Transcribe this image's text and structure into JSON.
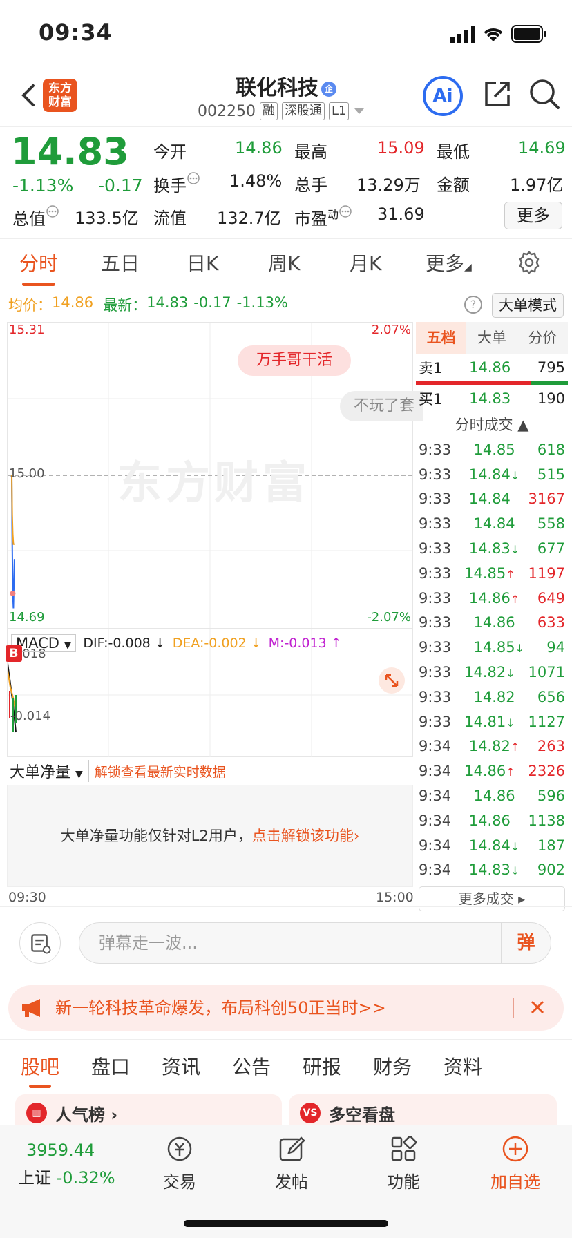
{
  "status": {
    "time": "09:34"
  },
  "header": {
    "logo": "东方财富",
    "title": "联化科技",
    "title_badge": "企",
    "code": "002250",
    "tags": [
      "融",
      "深股通",
      "L1"
    ],
    "ai": "Ai"
  },
  "quote": {
    "price": "14.83",
    "pct": "-1.13%",
    "chg": "-0.17",
    "rows": [
      [
        {
          "l": "今开",
          "v": "14.86",
          "c": "green"
        },
        {
          "l": "最高",
          "v": "15.09",
          "c": "red"
        },
        {
          "l": "最低",
          "v": "14.69",
          "c": "green"
        }
      ],
      [
        {
          "l": "换手",
          "v": "1.48%",
          "c": ""
        },
        {
          "l": "总手",
          "v": "13.29万",
          "c": ""
        },
        {
          "l": "金额",
          "v": "1.97亿",
          "c": ""
        }
      ],
      [
        {
          "l": "总值",
          "v": "133.5亿",
          "c": ""
        },
        {
          "l": "流值",
          "v": "132.7亿",
          "c": ""
        },
        {
          "l": "市盈",
          "v": "31.69",
          "c": ""
        }
      ]
    ],
    "pe_sup": "动",
    "more": "更多"
  },
  "ktabs": [
    "分时",
    "五日",
    "日K",
    "周K",
    "月K",
    "更多"
  ],
  "info": {
    "avg_label": "均价：",
    "avg": "14.86",
    "latest_label": "最新：",
    "latest": "14.83",
    "chg": "-0.17",
    "pct": "-1.13%",
    "help": "?",
    "mode": "大单模式"
  },
  "chart": {
    "y_top": "15.31",
    "y_bottom": "14.69",
    "pct_top": "2.07%",
    "pct_bottom": "-2.07%",
    "y_mid": "15.00",
    "bubble": "万手哥干活",
    "bubble2": "不玩了套",
    "watermark": "东方财富",
    "time_start": "09:30",
    "time_end": "15:00"
  },
  "chart_data": {
    "type": "line",
    "title": "",
    "ylim": [
      14.69,
      15.31
    ],
    "series": [
      {
        "color": "#2d6cf0",
        "points": [
          [
            0,
            15.0
          ],
          [
            0.3,
            14.86
          ],
          [
            0.6,
            14.76
          ],
          [
            1,
            14.73
          ],
          [
            1.6,
            14.83
          ]
        ]
      },
      {
        "color": "#f0a020",
        "points": [
          [
            0,
            15.0
          ],
          [
            0.3,
            14.92
          ],
          [
            0.6,
            14.88
          ],
          [
            1,
            14.86
          ],
          [
            1.6,
            14.86
          ]
        ]
      }
    ]
  },
  "macd": {
    "label": "MACD",
    "dif": "DIF:-0.008 ↓",
    "dea": "DEA:-0.002 ↓",
    "m": "M:-0.013 ↑",
    "top": "0.018",
    "bottom": "-0.014",
    "b": "B"
  },
  "bigorder": {
    "label": "大单净量",
    "link": "解锁查看最新实时数据",
    "msg": "大单净量功能仅针对L2用户，",
    "msg_link": "点击解锁该功能›"
  },
  "rpanel": {
    "tabs": [
      "五档",
      "大单",
      "分价"
    ],
    "sell1": {
      "l": "卖1",
      "p": "14.86",
      "v": "795"
    },
    "buy1": {
      "l": "买1",
      "p": "14.83",
      "v": "190"
    },
    "tick_head": "分时成交 ▲",
    "trades": [
      [
        "9:33",
        "14.85",
        "",
        "618",
        "green"
      ],
      [
        "9:33",
        "14.84",
        "↓",
        "515",
        "green"
      ],
      [
        "9:33",
        "14.84",
        "",
        "3167",
        "red"
      ],
      [
        "9:33",
        "14.84",
        "",
        "558",
        "green"
      ],
      [
        "9:33",
        "14.83",
        "↓",
        "677",
        "green"
      ],
      [
        "9:33",
        "14.85",
        "↑",
        "1197",
        "red"
      ],
      [
        "9:33",
        "14.86",
        "↑",
        "649",
        "red"
      ],
      [
        "9:33",
        "14.86",
        "",
        "633",
        "red"
      ],
      [
        "9:33",
        "14.85",
        "↓",
        "94",
        "green"
      ],
      [
        "9:33",
        "14.82",
        "↓",
        "1071",
        "green"
      ],
      [
        "9:33",
        "14.82",
        "",
        "656",
        "green"
      ],
      [
        "9:33",
        "14.81",
        "↓",
        "1127",
        "green"
      ],
      [
        "9:34",
        "14.82",
        "↑",
        "263",
        "red"
      ],
      [
        "9:34",
        "14.86",
        "↑",
        "2326",
        "red"
      ],
      [
        "9:34",
        "14.86",
        "",
        "596",
        "green"
      ],
      [
        "9:34",
        "14.86",
        "",
        "1138",
        "green"
      ],
      [
        "9:34",
        "14.84",
        "↓",
        "187",
        "green"
      ],
      [
        "9:34",
        "14.83",
        "↓",
        "902",
        "green"
      ]
    ],
    "more": "更多成交 ▸"
  },
  "danmu": {
    "placeholder": "弹幕走一波...",
    "send": "弹"
  },
  "banner": {
    "text": "新一轮科技革命爆发，布局科创50正当时>>"
  },
  "btabs": [
    "股吧",
    "盘口",
    "资讯",
    "公告",
    "研报",
    "财务",
    "资料"
  ],
  "cards": [
    {
      "label": "人气榜 ›"
    },
    {
      "label": "多空看盘"
    }
  ],
  "bnav": {
    "index_value": "3959.44",
    "index_name": "上证",
    "index_pct": "-0.32%",
    "items": [
      "交易",
      "发帖",
      "功能",
      "加自选"
    ]
  }
}
